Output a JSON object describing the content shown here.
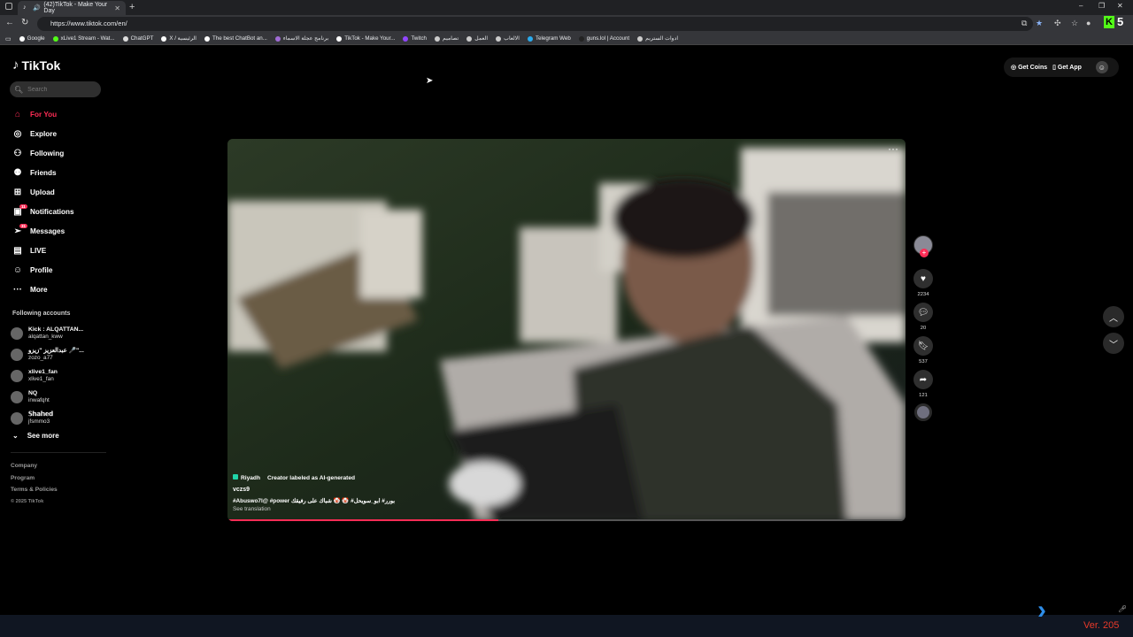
{
  "browser": {
    "tab_title": "(42)TikTok - Make Your Day",
    "url": "https://www.tiktok.com/en/",
    "extension_letter": "K",
    "extension_count": "5",
    "bookmarks": [
      {
        "label": "Google",
        "color": "#ffffff"
      },
      {
        "label": "xLive1 Stream - Wat...",
        "color": "#53fc18"
      },
      {
        "label": "ChatGPT",
        "color": "#dddddd"
      },
      {
        "label": "X / الرئيسية",
        "color": "#ffffff"
      },
      {
        "label": "The best ChatBot an...",
        "color": "#ffffff"
      },
      {
        "label": "برنامج عجلة الاسماء",
        "color": "#a06cd5"
      },
      {
        "label": "TikTok - Make Your...",
        "color": "#ffffff"
      },
      {
        "label": "Twitch",
        "color": "#9146ff"
      },
      {
        "label": "تصاميم",
        "color": "#cccccc"
      },
      {
        "label": "العمل",
        "color": "#cccccc"
      },
      {
        "label": "الالعاب",
        "color": "#cccccc"
      },
      {
        "label": "Telegram Web",
        "color": "#2aabee"
      },
      {
        "label": "guns.lol | Account",
        "color": "#222222"
      },
      {
        "label": "ادوات الستريم",
        "color": "#cccccc"
      }
    ]
  },
  "sidebar": {
    "logo": "TikTok",
    "search_placeholder": "Search",
    "nav": [
      {
        "label": "For You",
        "icon": "home-icon",
        "active": true
      },
      {
        "label": "Explore",
        "icon": "compass-icon"
      },
      {
        "label": "Following",
        "icon": "following-icon"
      },
      {
        "label": "Friends",
        "icon": "friends-icon"
      },
      {
        "label": "Upload",
        "icon": "upload-icon"
      },
      {
        "label": "Notifications",
        "icon": "inbox-icon",
        "badge": "11"
      },
      {
        "label": "Messages",
        "icon": "send-icon",
        "badge": "31"
      },
      {
        "label": "LIVE",
        "icon": "live-icon"
      },
      {
        "label": "Profile",
        "icon": "profile-icon"
      },
      {
        "label": "More",
        "icon": "more-icon"
      }
    ],
    "following_title": "Following accounts",
    "accounts": [
      {
        "name": "Kick : ALQATTAN...",
        "handle": "alqattan_kww"
      },
      {
        "name": "عبدالعزيز \"زيزو 🎤\"...",
        "handle": "zozo_a77"
      },
      {
        "name": "xlive1_fan",
        "handle": "xlive1_fan"
      },
      {
        "name": "NQ",
        "handle": "inwafqht"
      },
      {
        "name": "𝕊𝕙𝕒𝕙𝕖𝕕",
        "handle": "jfsmmo3"
      }
    ],
    "see_more": "See more",
    "footer": [
      "Company",
      "Program",
      "Terms & Policies"
    ],
    "copyright": "© 2025 TikTok"
  },
  "topbar": {
    "get_coins": "Get Coins",
    "get_app": "Get App"
  },
  "video": {
    "location": "Riyadh",
    "ai_label": "Creator labeled as AI-generated",
    "username": "vczs9",
    "caption": "#Abuswo7l@ #power بورر# ابو_سويحل# 🤡 🤡 شباك على رفيقك",
    "see_translation": "See translation",
    "progress": 0.4,
    "likes": "2234",
    "comments": "20",
    "saves": "537",
    "shares": "121"
  },
  "taskbar": {
    "version": "Ver. 205"
  }
}
